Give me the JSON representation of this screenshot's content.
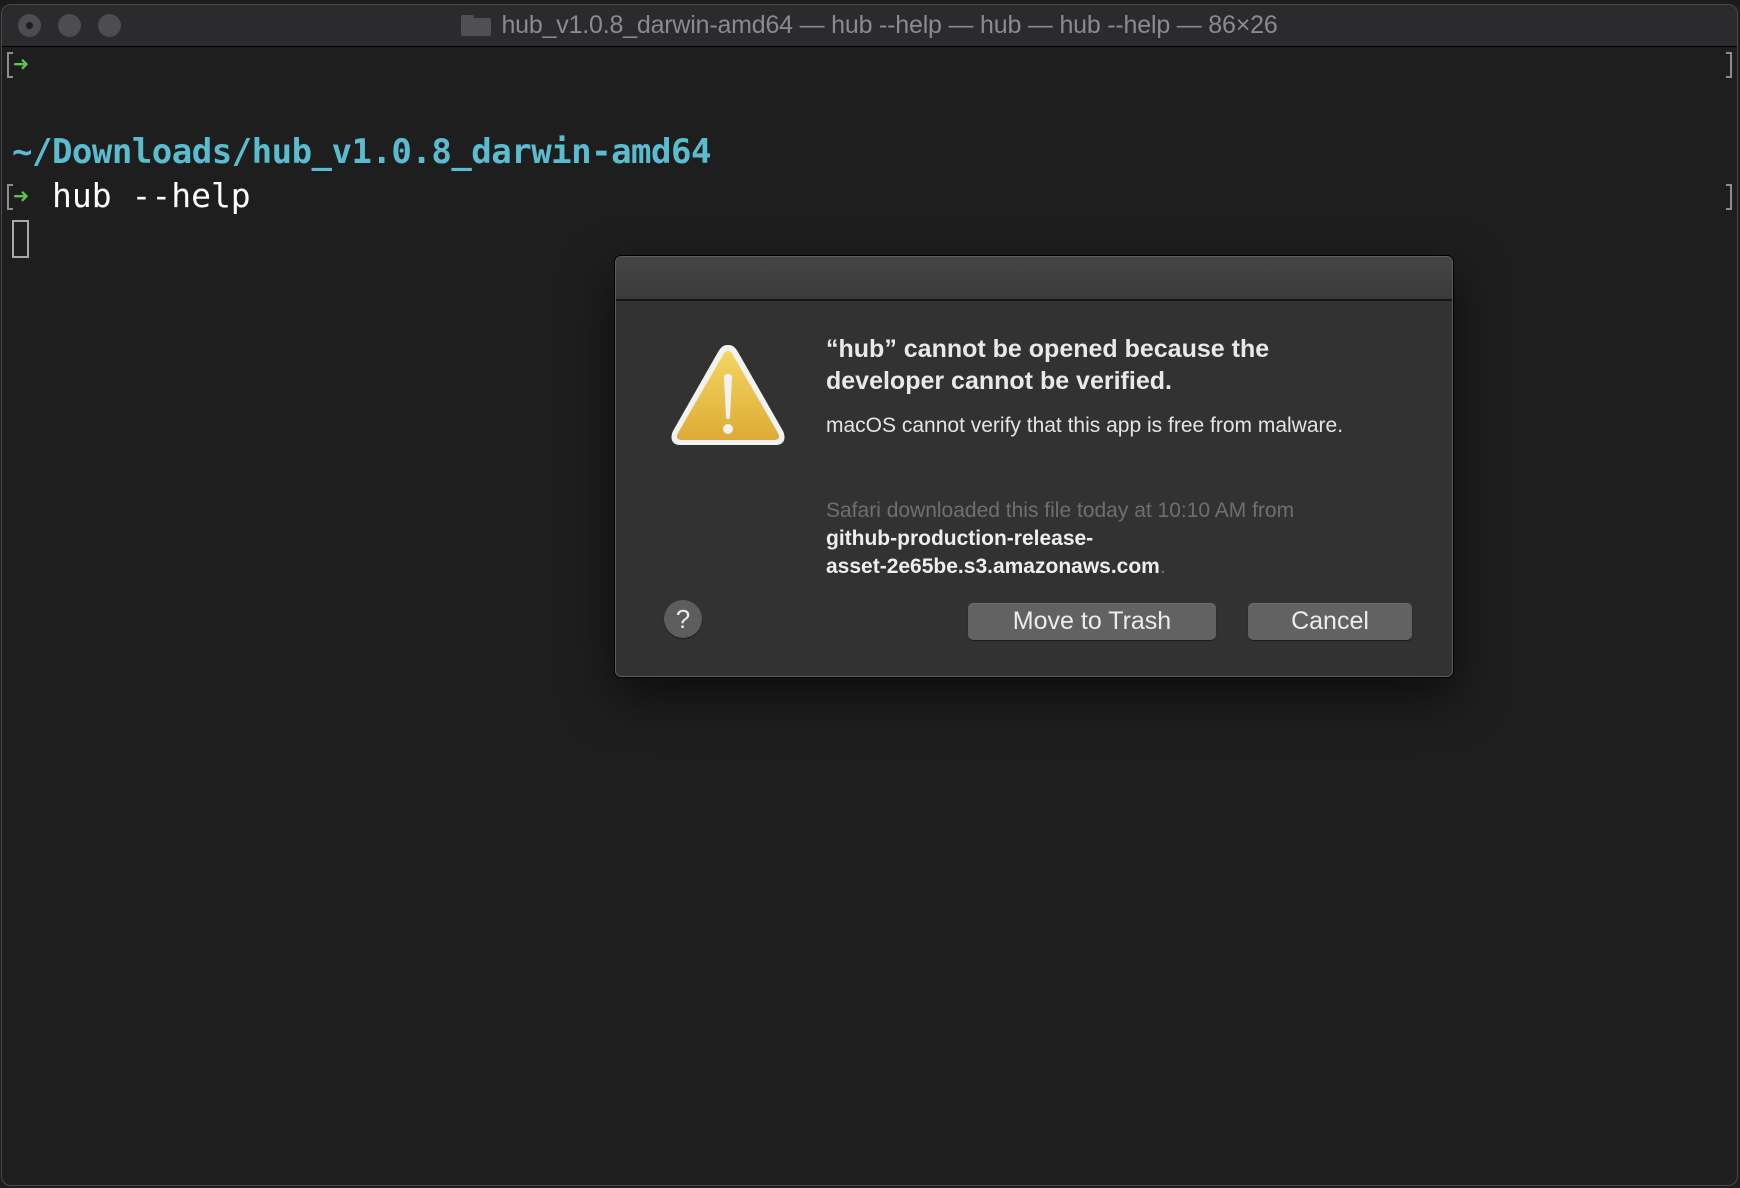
{
  "window": {
    "title": "hub_v1.0.8_darwin-amd64 — hub --help — hub — hub --help — 86×26",
    "title_icon": "folder-icon",
    "traffic_lights": [
      "close",
      "minimize",
      "zoom"
    ]
  },
  "terminal": {
    "prompt_symbol": "➜",
    "path": "~/Downloads/hub_v1.0.8_darwin-amd64",
    "command": "hub --help",
    "colors": {
      "path": "#5bbccf",
      "prompt": "#5fc34c",
      "background": "#1e1e1e"
    }
  },
  "dialog": {
    "icon": "warning-triangle-icon",
    "heading": "“hub” cannot be opened because the developer cannot be verified.",
    "body": "macOS cannot verify that this app is free from malware.",
    "source_prefix": "Safari downloaded this file today at 10:10 AM from",
    "source_host_line1": "github-production-release-",
    "source_host_line2": "asset-2e65be.s3.amazonaws.com",
    "source_suffix": ".",
    "help_label": "?",
    "buttons": {
      "move_to_trash": "Move to Trash",
      "cancel": "Cancel"
    }
  }
}
